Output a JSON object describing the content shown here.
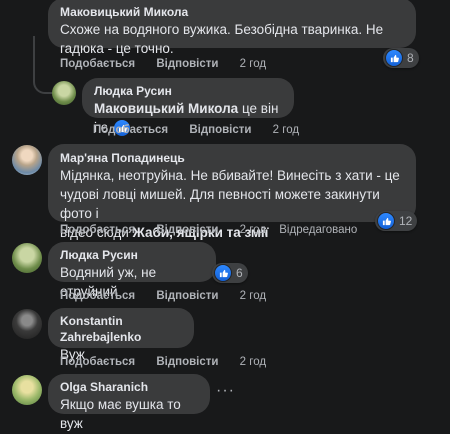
{
  "comments": [
    {
      "author": "Маковицький Микола",
      "text_line1": "Схоже на водяного вужика. Безобідна тваринка. Не",
      "text_line2": "гадюка - це точно.",
      "like_label": "Подобається",
      "reply_label": "Відповісти",
      "time": "2 год",
      "reactions": "8"
    },
    {
      "author": "Людка Русин",
      "mention": "Маковицький Микола",
      "text_rest": "це він і є",
      "like_label": "Подобається",
      "reply_label": "Відповісти",
      "time": "2 год"
    },
    {
      "author": "Мар'яна Попадинець",
      "text_line1": "Мідянка, неотруйна. Не вбивайте! Винесіть з хати - це",
      "text_line2": "чудові ловці мишей. Для певності можете закинути фото і",
      "text_line3_pre": "відео сюди",
      "text_line3_link": "Жаби, ящірки та змії",
      "like_label": "Подобається",
      "reply_label": "Відповісти",
      "time": "2 год",
      "edited": "Відредаговано",
      "reactions": "12"
    },
    {
      "author": "Людка Русин",
      "text": "Водяний уж, не отруйний",
      "like_label": "Подобається",
      "reply_label": "Відповісти",
      "time": "2 год",
      "reactions": "6"
    },
    {
      "author": "Konstantin Zahrebajlenko",
      "text": "Вуж",
      "like_label": "Подобається",
      "reply_label": "Відповісти",
      "time": "2 год"
    },
    {
      "author": "Olga Sharanich",
      "text": "Якщо має вушка то вуж",
      "more": "···"
    }
  ],
  "colors": {
    "background": "#18191a",
    "bubble": "#3a3b3c",
    "like_blue": "#2d88ff"
  },
  "icons": {
    "reaction": "like-thumb-icon",
    "more": "more-options-icon"
  }
}
